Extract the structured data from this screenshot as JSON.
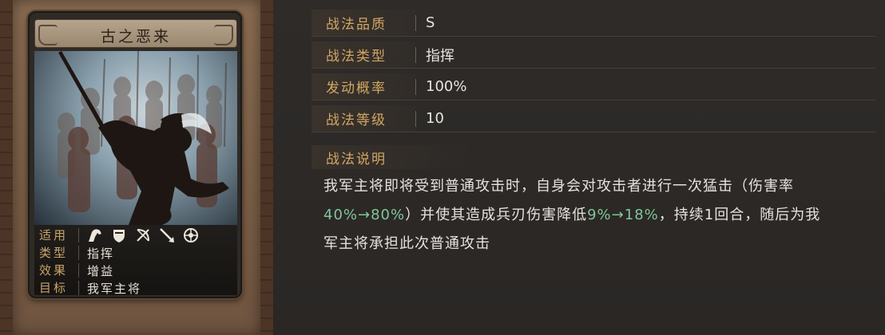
{
  "skill_card": {
    "title": "古之恶来",
    "info": {
      "troops_label": "适用",
      "troop_icons": [
        "cavalry-icon",
        "shield-icon",
        "bow-icon",
        "spear-icon",
        "siege-icon"
      ],
      "type_label": "类型",
      "type_value": "指挥",
      "effect_label": "效果",
      "effect_value": "增益",
      "target_label": "目标",
      "target_value": "我军主将"
    }
  },
  "attributes": [
    {
      "label": "战法品质",
      "value": "S"
    },
    {
      "label": "战法类型",
      "value": "指挥"
    },
    {
      "label": "发动概率",
      "value": "100%"
    },
    {
      "label": "战法等级",
      "value": "10"
    }
  ],
  "description": {
    "heading": "战法说明",
    "part1": "我军主将即将受到普通攻击时，自身会对攻击者进行一次猛击（伤害率",
    "hl1": "40%→80%",
    "part2": "）并使其造成兵刃伤害降低",
    "hl2": "9%→18%",
    "part3": "，持续1回合，随后为我军主将承担此次普通攻击"
  },
  "colors": {
    "label_gold": "#d2a765",
    "highlight_green": "#7fc79a",
    "text_light": "#e8e4de"
  }
}
